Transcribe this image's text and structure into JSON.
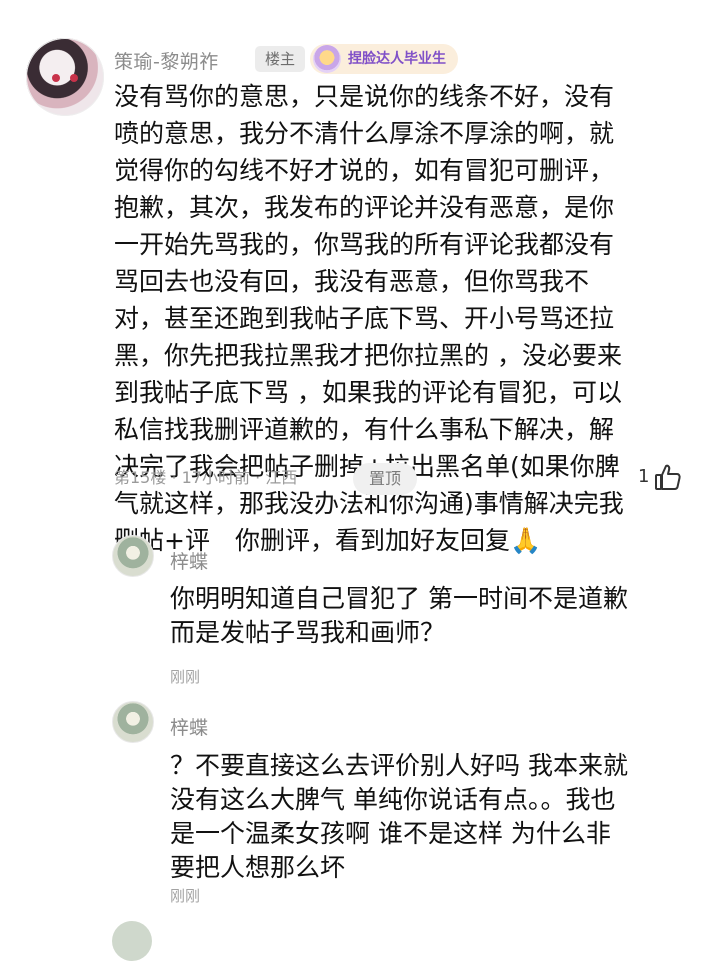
{
  "post": {
    "username": "策瑜-黎朔祚",
    "owner_badge": "楼主",
    "achievement_badge": "捏脸达人毕业生",
    "lines": [
      "没有骂你的意思，只是说你的线条不好，没有",
      "喷的意思，我分不清什么厚涂不厚涂的啊，就",
      "觉得你的勾线不好才说的，如有冒犯可删评，",
      "抱歉，其次，我发布的评论并没有恶意，是你",
      "一开始先骂我的，你骂我的所有评论我都没有",
      "骂回去也没有回，我没有恶意，但你骂我不",
      "对，甚至还跑到我帖子底下骂、开小号骂还拉",
      "黑，你先把我拉黑我才把你拉黑的 ，没必要来",
      "到我帖子底下骂 ，如果我的评论有冒犯，可以",
      "私信找我删评道歉的，有什么事私下解决，解",
      "决完了我会把帖子删掉+拉出黑名单(如果你脾",
      "气就这样，那我没办法和你沟通)事情解决完我",
      "删帖+评　你删评，看到加好友回复🙏"
    ],
    "meta": "第15楼 · 17小时前 · 江西",
    "pin_label": "置顶",
    "like_count": "1"
  },
  "replies": [
    {
      "username": "梓蝶",
      "lines": [
        "你明明知道自己冒犯了 第一时间不是道歉",
        "而是发帖子骂我和画师？"
      ],
      "time": "刚刚"
    },
    {
      "username": "梓蝶",
      "lines": [
        "？不要直接这么去评价别人好吗 我本来就",
        "没有这么大脾气 单纯你说话有点。。我也",
        "是一个温柔女孩啊 谁不是这样 为什么非",
        "要把人想那么坏"
      ],
      "time": "刚刚"
    }
  ]
}
